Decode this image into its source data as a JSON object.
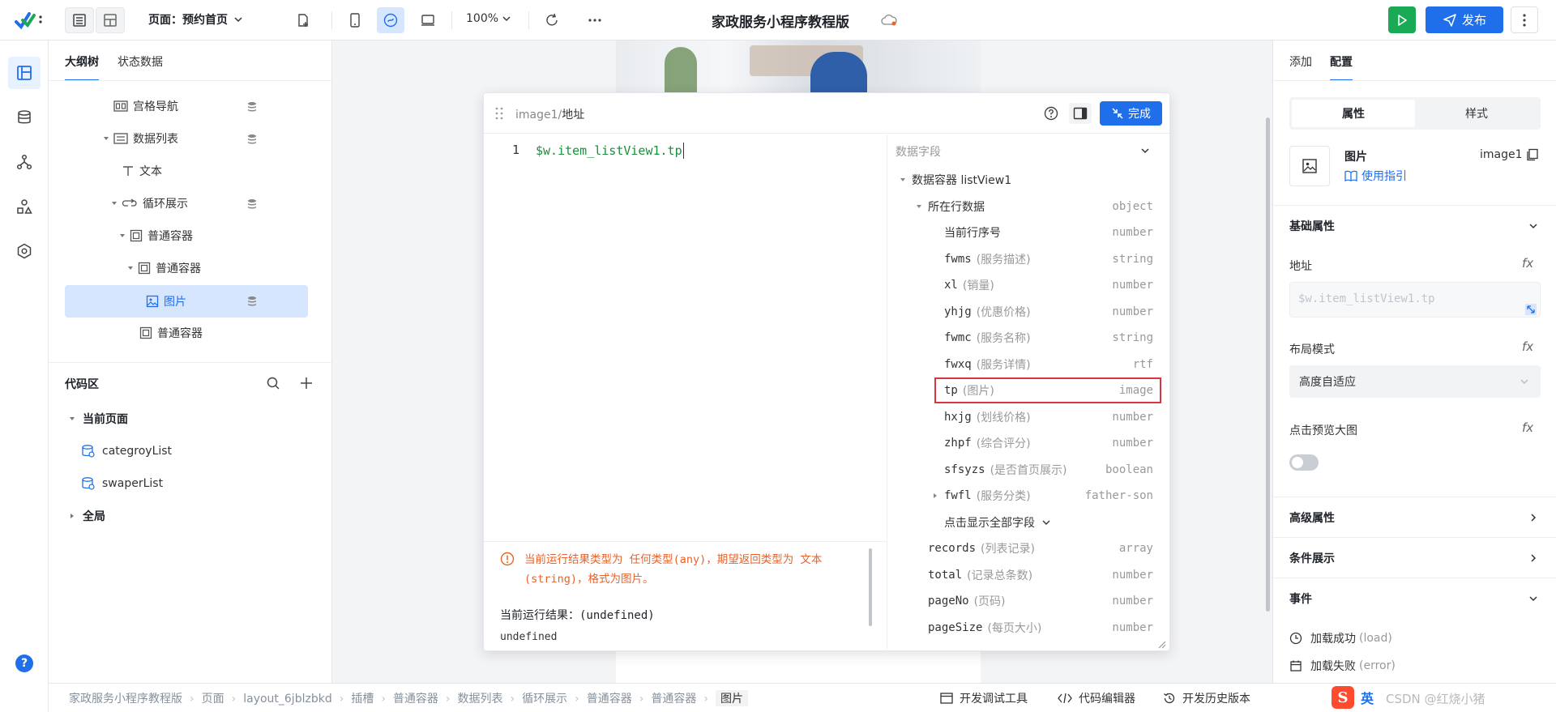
{
  "topbar": {
    "page_label": "页面：预约首页",
    "zoom": "100%",
    "app_title": "家政服务小程序教程版",
    "publish_label": "发布"
  },
  "leftpanel": {
    "tabs": [
      "大纲树",
      "状态数据"
    ],
    "tree": [
      {
        "label": "宫格导航",
        "icon": "grid-icon"
      },
      {
        "label": "数据列表",
        "icon": "list-icon"
      },
      {
        "label": "文本",
        "icon": "text-icon"
      },
      {
        "label": "循环展示",
        "icon": "loop-icon"
      },
      {
        "label": "普通容器",
        "icon": "container-icon"
      },
      {
        "label": "普通容器",
        "icon": "container-icon"
      },
      {
        "label": "图片",
        "icon": "image-icon"
      },
      {
        "label": "普通容器",
        "icon": "container-icon"
      }
    ],
    "code_title": "代码区",
    "current_page": "当前页面",
    "code_items": [
      "categroyList",
      "swaperList"
    ],
    "global": "全局"
  },
  "editor": {
    "path_prefix": "image1/",
    "path_name": "地址",
    "done_label": "完成",
    "line_no": "1",
    "code": "$w.item_listView1.tp",
    "warning": "当前运行结果类型为 任何类型(any)，期望返回类型为 文本(string)，格式为图片。",
    "result_label": "当前运行结果：",
    "result_value": "(undefined)",
    "result_output": "undefined",
    "fields_title": "数据字段",
    "container_label": "数据容器 listView1",
    "row_data": {
      "name": "所在行数据",
      "type": "object"
    },
    "fields": [
      {
        "name": "当前行序号",
        "desc": "",
        "type": "number"
      },
      {
        "name": "fwms",
        "desc": "(服务描述)",
        "type": "string"
      },
      {
        "name": "xl",
        "desc": "(销量)",
        "type": "number"
      },
      {
        "name": "yhjg",
        "desc": "(优惠价格)",
        "type": "number"
      },
      {
        "name": "fwmc",
        "desc": "(服务名称)",
        "type": "string"
      },
      {
        "name": "fwxq",
        "desc": "(服务详情)",
        "type": "rtf"
      },
      {
        "name": "tp",
        "desc": "(图片)",
        "type": "image"
      },
      {
        "name": "hxjg",
        "desc": "(划线价格)",
        "type": "number"
      },
      {
        "name": "zhpf",
        "desc": "(综合评分)",
        "type": "number"
      },
      {
        "name": "sfsyzs",
        "desc": "(是否首页展示)",
        "type": "boolean"
      },
      {
        "name": "fwfl",
        "desc": "(服务分类)",
        "type": "father-son"
      }
    ],
    "show_all": "点击显示全部字段",
    "list_fields": [
      {
        "name": "records",
        "desc": "(列表记录)",
        "type": "array"
      },
      {
        "name": "total",
        "desc": "(记录总条数)",
        "type": "number"
      },
      {
        "name": "pageNo",
        "desc": "(页码)",
        "type": "number"
      },
      {
        "name": "pageSize",
        "desc": "(每页大小)",
        "type": "number"
      }
    ]
  },
  "rightpanel": {
    "tabs": [
      "添加",
      "配置"
    ],
    "seg": [
      "属性",
      "样式"
    ],
    "comp_name": "图片",
    "comp_id": "image1",
    "guide": "使用指引",
    "basic_title": "基础属性",
    "addr_label": "地址",
    "addr_value": "$w.item_listView1.tp",
    "layout_label": "布局模式",
    "layout_value": "高度自适应",
    "preview_label": "点击预览大图",
    "advanced": "高级属性",
    "conditional": "条件展示",
    "events": "事件",
    "event_items": [
      {
        "label": "加载成功",
        "sub": "(load)"
      },
      {
        "label": "加载失败",
        "sub": "(error)"
      }
    ]
  },
  "bottombar": {
    "breadcrumb": [
      "家政服务小程序教程版",
      "页面",
      "layout_6jblzbkd",
      "插槽",
      "普通容器",
      "数据列表",
      "循环展示",
      "普通容器",
      "普通容器",
      "图片"
    ],
    "tools": [
      "开发调试工具",
      "代码编辑器",
      "开发历史版本"
    ],
    "ime": "英",
    "watermark": "CSDN @红烧小猪"
  },
  "colors": {
    "accent": "#1f6feb",
    "run": "#1aaa55",
    "warning": "#e8622a",
    "highlight": "#d9363e"
  }
}
